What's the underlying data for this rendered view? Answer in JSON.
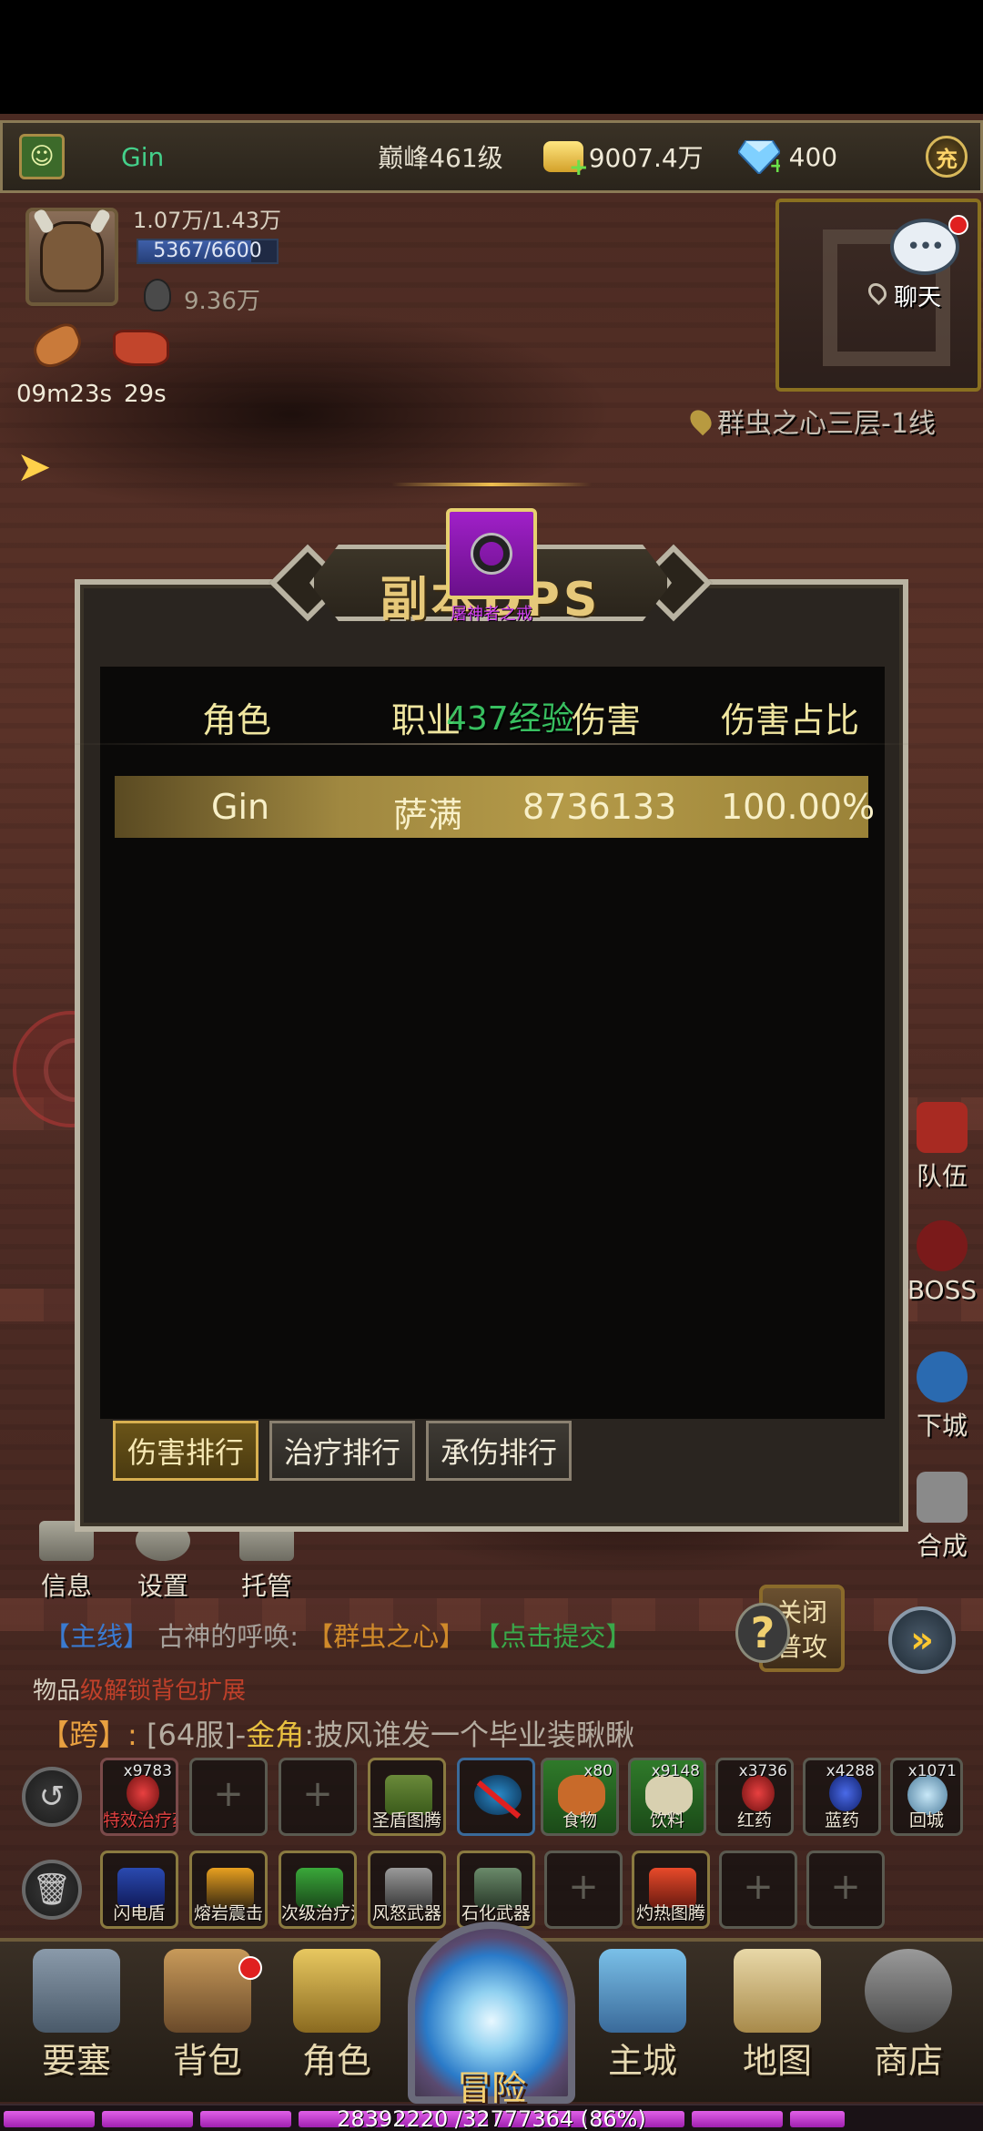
{
  "topbar": {
    "player_name": "Gin",
    "level": "巅峰461级",
    "gold": "9007.4万",
    "gems": "400",
    "charge_label": "充"
  },
  "player": {
    "hp": "1.07万/1.43万",
    "mp": "5367/6600",
    "mp_ratio": 0.813,
    "power": "9.36万",
    "buffs": [
      {
        "icon": "roast-meat-icon",
        "timer": "09m23s"
      },
      {
        "icon": "steak-icon",
        "timer": "29s"
      }
    ]
  },
  "map": {
    "chat_label": "聊天",
    "location": "群虫之心三层-1线"
  },
  "dps": {
    "title": "副本DPS",
    "item_name": "屠神者之戒",
    "exp_popup": "437经验",
    "headers": [
      "角色",
      "职业",
      "伤害",
      "伤害占比"
    ],
    "rows": [
      {
        "name": "Gin",
        "class": "萨满",
        "damage": "8736133",
        "share": "100.00%"
      }
    ],
    "tabs": [
      "伤害排行",
      "治疗排行",
      "承伤排行"
    ],
    "active_tab": 0
  },
  "side_buttons": [
    "队伍",
    "BOSS",
    "下城",
    "合成"
  ],
  "hud_buttons": [
    "信息",
    "设置",
    "托管"
  ],
  "quest": {
    "tag": "【主线】",
    "name": "古神的呼唤:",
    "target": "【群虫之心】",
    "action": "【点击提交】"
  },
  "close_attack": [
    "关闭",
    "普攻"
  ],
  "system_line": {
    "tag": "物品",
    "text": "级解锁背包扩展"
  },
  "chat": {
    "channel": "【跨】:",
    "server": "[64服]-",
    "sender": "金角",
    "message": ":披风谁发一个毕业装瞅瞅"
  },
  "quick_slots_row1": [
    {
      "label": "特效治疗药",
      "count": "x9783"
    },
    {
      "label": "",
      "count": ""
    },
    {
      "label": "",
      "count": ""
    },
    {
      "label": "圣盾图腾",
      "count": ""
    },
    {
      "label": "",
      "count": ""
    },
    {
      "label": "食物",
      "count": "x80"
    },
    {
      "label": "饮料",
      "count": "x9148"
    },
    {
      "label": "红药",
      "count": "x3736"
    },
    {
      "label": "蓝药",
      "count": "x4288"
    },
    {
      "label": "回城",
      "count": "x1071"
    }
  ],
  "quick_slots_row2": [
    {
      "label": "闪电盾"
    },
    {
      "label": "熔岩震击"
    },
    {
      "label": "次级治疗波"
    },
    {
      "label": "风怒武器"
    },
    {
      "label": "石化武器"
    },
    {
      "label": ""
    },
    {
      "label": "灼热图腾"
    },
    {
      "label": ""
    },
    {
      "label": ""
    }
  ],
  "bottom_nav": [
    "要塞",
    "背包",
    "角色",
    "冒险",
    "主城",
    "地图",
    "商店"
  ],
  "exp": {
    "text": "28392220 /32777364 (86%)",
    "ratio": 0.86
  },
  "colors": {
    "accent_gold": "#e6c87a",
    "name_green": "#44d08a",
    "exp_purple": "#d040e0",
    "item_purple": "#a020c8"
  }
}
